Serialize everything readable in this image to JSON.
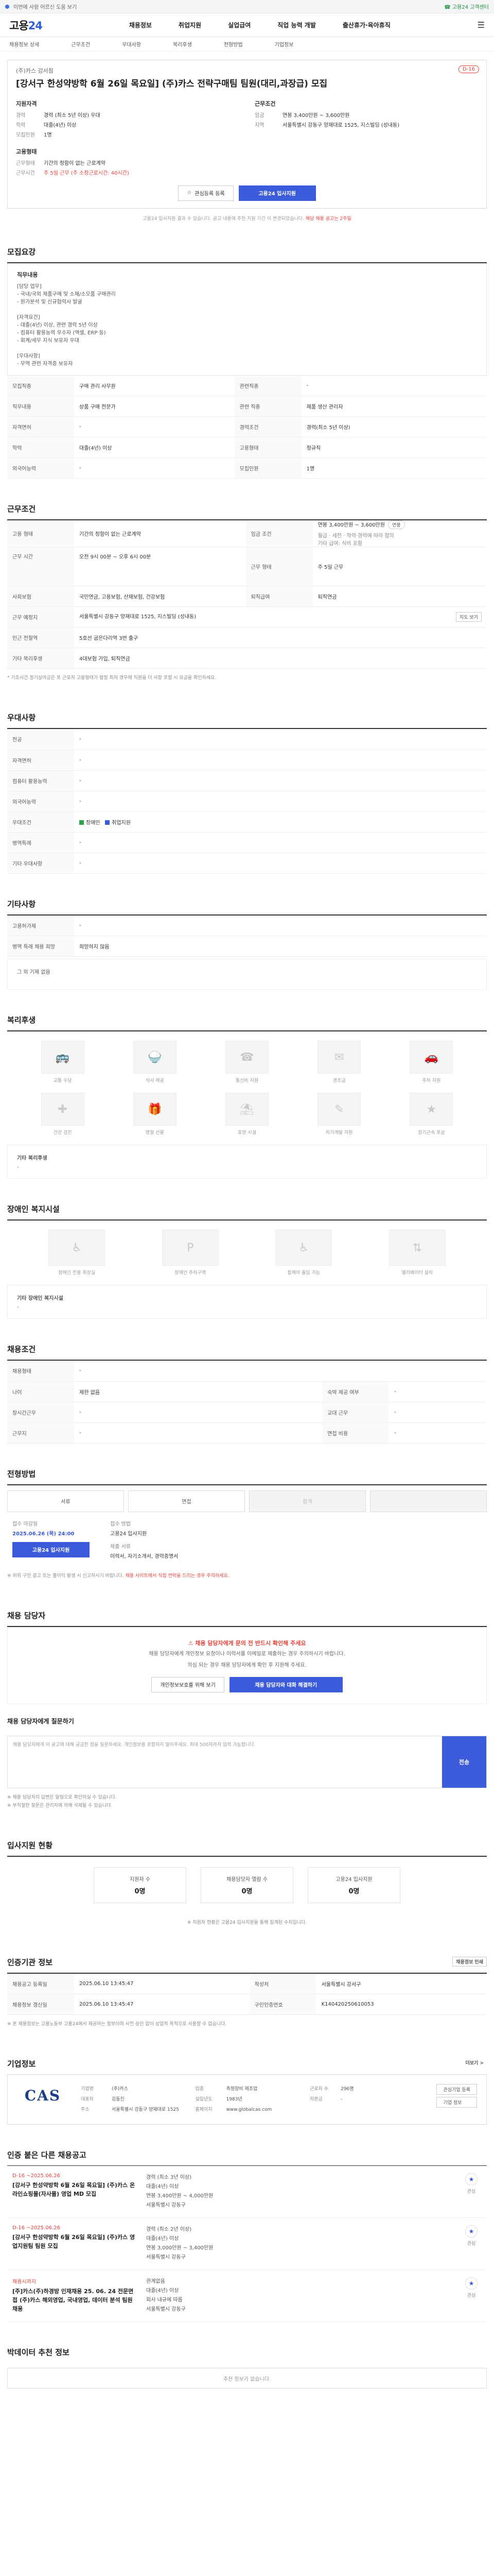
{
  "topbar": {
    "notice": "이번에 사람 어르신 도움 보기",
    "help": "☎ 고용24 고객센터"
  },
  "header": {
    "logo_a": "고용",
    "logo_b": "24",
    "gnb": [
      "채용정보",
      "취업지원",
      "실업급여",
      "직업 능력 개발",
      "출산휴가·육아휴직"
    ]
  },
  "subnav": [
    "채용정보 상세",
    "근무조건",
    "우대사항",
    "복리후생",
    "전형방법",
    "기업정보"
  ],
  "job": {
    "dday": "D-16",
    "company": "(주)카스 강서점",
    "title": "[강서구 한성약방학 6월 26일 목요일] (주)카스 전략구매팀 팀원(대리,과장급) 모집",
    "left_head": "지원자격",
    "left": [
      {
        "k": "경력",
        "v": "경력 (최소 5년 이상) 우대"
      },
      {
        "k": "학력",
        "v": "대졸(4년) 이상"
      },
      {
        "k": "모집인원",
        "v": "1명"
      }
    ],
    "right_head": "근무조건",
    "right": [
      {
        "k": "임금",
        "v": "연봉 3,400만원 ~ 3,600만원"
      },
      {
        "k": "지역",
        "v": "서울특별시 강동구 양재대로 1525, 지스빌딩 (성내동)"
      }
    ],
    "left2_head": "고용형태",
    "left2": [
      {
        "k": "근무형태",
        "v": "기간의 정함이 없는 근로계약"
      },
      {
        "k": "근무시간",
        "v": "주 5일 근무 (주 소정근로시간: 40시간)"
      }
    ],
    "scrap": "관심등록 등록",
    "apply": "고용24 입사지원",
    "note": "고용24 입사지원 결과 수 있습니다. 공고 내용에 추천 지원 기간 이 변경되었습니다.",
    "note_red": "해당 채용 공고는 2주일"
  },
  "detail": {
    "title": "모집요강",
    "heading": "직무내용",
    "lines": [
      "[담당 업무]",
      "- 국내/국외 제품구매 및 소재/소모품 구매관리",
      "- 원가분석 및 신규협력사 발굴",
      "",
      "[자격요건]",
      "- 대졸(4년) 이상, 관련 경력 5년 이상",
      "- 컴퓨터 활용능력 우수자 (엑셀, ERP 등)",
      "- 회계/세무 지식 보유자 우대",
      "",
      "[우대사항]",
      "- 무역 관련 자격증 보유자"
    ],
    "btn": "상세보기 ▾"
  },
  "recruit_tbl": [
    {
      "k": "모집직종",
      "v": "구매 관리 사무원",
      "k2": "관련직종",
      "v2": "-"
    },
    {
      "k": "직무내용",
      "v": "상품 구매 전문가",
      "k2": "관련 직종",
      "v2": "제품 생산 관리자"
    },
    {
      "k": "자격면허",
      "v": "-",
      "k2": "경력조건",
      "v2": "경력(최소 5년 이상)"
    },
    {
      "k": "학력",
      "v": "대졸(4년) 이상",
      "k2": "고용형태",
      "v2": "정규직"
    },
    {
      "k": "외국어능력",
      "v": "-",
      "k2": "모집인원",
      "v2": "1명"
    }
  ],
  "work": {
    "title": "근무조건",
    "rows": [
      {
        "k": "고용 형태",
        "v": "기간의 정함이 없는 근로계약",
        "k2": "임금 조건",
        "v2": "연봉 3,400만원 ~ 3,600만원",
        "pill": "연봉"
      },
      {
        "k": "근무 시간",
        "v": "오전 9시 00분 ~ 오후 6시 00분",
        "k2": "근무 형태",
        "v2": "주 5일 근무"
      },
      {
        "k": "사회보험",
        "v": "국민연금, 고용보험, 산재보험, 건강보험",
        "k2": "퇴직급여",
        "v2": "퇴직연금"
      },
      {
        "k": "근무 예정지",
        "v": "서울특별시 강동구 양재대로 1525, 지스빌딩 (성내동)",
        "k2": "",
        "v2": "",
        "btn": "지도 보기"
      },
      {
        "k": "인근 전철역",
        "v": "5호선 굽은다리역 3번 출구",
        "k2": "",
        "v2": ""
      },
      {
        "k": "기타 복리후생",
        "v": "4대보험 가입, 퇴직연금",
        "k2": "",
        "v2": ""
      }
    ],
    "pay_note": "월급 · 세전 · 학력·경력에 따라 협의",
    "pay_note2": "기타 급여: 식비 포함",
    "footnote": "* 기초시간 정기상여금은 포 근로자 고용형태가 법정 최저 경우에 직원을 더 사항 포함 시 요금을 확인하세요."
  },
  "pref": {
    "title": "우대사항",
    "rows": [
      {
        "k": "전공",
        "v": "-"
      },
      {
        "k": "자격면허",
        "v": "-"
      },
      {
        "k": "컴퓨터 활용능력",
        "v": "-"
      },
      {
        "k": "외국어능력",
        "v": "-"
      },
      {
        "k": "우대조건",
        "v1": "장애인",
        "v2": "취업지원"
      },
      {
        "k": "병역특례",
        "v": "-"
      },
      {
        "k": "기타 우대사항",
        "v": "-"
      }
    ]
  },
  "etc": {
    "title": "기타사항",
    "rows": [
      {
        "k": "고용허가제",
        "v": "-"
      },
      {
        "k": "병역 특례 채용 희망",
        "v": "희망하지 않음"
      }
    ],
    "extra": "그 외 기재 없음"
  },
  "welfare": {
    "title": "복리후생",
    "items": [
      "교통 수당",
      "식사 제공",
      "통신비 지원",
      "경조금",
      "주차 지원",
      "건강 검진",
      "명절 선물",
      "휴양 시설",
      "자기계발 지원",
      "장기근속 포상"
    ],
    "other_head": "기타 복리후생",
    "other": "-"
  },
  "disable": {
    "title": "장애인 복지시설",
    "items": [
      "장애인 전용 화장실",
      "장애인 주차구역",
      "휠체어 출입 가능",
      "엘리베이터 설치"
    ],
    "other_head": "기타 장애인 복지시설",
    "other": "-"
  },
  "cond": {
    "title": "채용조건",
    "rows": [
      {
        "k": "채용형태",
        "v": "-"
      },
      {
        "k": "나이",
        "v": "제한 없음",
        "k2": "숙박 제공 여부",
        "v2": "-"
      },
      {
        "k": "장시간근무",
        "v": "-",
        "k2": "교대 근무",
        "v2": "-"
      },
      {
        "k": "근무지",
        "v": "-",
        "k2": "면접 비용",
        "v2": "-"
      }
    ]
  },
  "process": {
    "title": "전형방법",
    "steps": [
      "서류",
      "면접",
      "합격",
      ""
    ],
    "period_head": "접수 마감일",
    "period_val": "2025.06.26 (목) 24:00",
    "period_head2": "접수 방법",
    "period_val2": "고용24 입사지원",
    "submit_head": "제출 서류",
    "submit_val": "이력서, 자기소개서, 경력증명서",
    "apply_btn": "고용24 입사지원",
    "note": "※ 허위 구인 광고 또는 불이익 발생 시 신고하시기 바랍니다.",
    "note_red": "채용 사이트에서 직접 연락을 드리는 경우 주의하세요."
  },
  "contact": {
    "title": "채용 담당자",
    "warn": "채용 담당자에게 문의 전 반드시 확인해 주세요",
    "desc": "채용 담당자에게 개인정보 요청이나 이력서를 이메일로 제출하는 경우 주의하시기 바랍니다.",
    "desc2": "의심 되는 경우 채용 담당자에게 확인 후 지원해 주세요.",
    "btn1": "개인정보보호를 위해 보기",
    "btn2": "채용 담당자와 대화 해결하기"
  },
  "inquiry": {
    "title": "채용 담당자에게 질문하기",
    "placeholder": "채용 담당자에게 이 공고에 대해 궁금한 점을 질문하세요. 개인정보를 포함하지 말아주세요. 최대 500자까지 입력 가능합니다.",
    "btn": "전송",
    "note1": "※ 채용 담당자의 답변은 알림으로 확인하실 수 있습니다.",
    "note2": "※ 부적절한 질문은 관리자에 의해 삭제될 수 있습니다."
  },
  "stats": {
    "title": "입사지원 현황",
    "items": [
      {
        "l": "지원자 수",
        "v": "0명"
      },
      {
        "l": "채용담당자 열람 수",
        "v": "0명"
      },
      {
        "l": "고용24 입사지원",
        "v": "0명"
      }
    ],
    "note": "※ 지원자 현황은 고용24 입사지원을 통해 집계된 수치입니다."
  },
  "info": {
    "title": "인증기관 정보",
    "rows": [
      {
        "k": "채용공고 등록일",
        "v": "2025.06.10 13:45:47",
        "k2": "작성처",
        "v2": "서울특별시 강서구"
      },
      {
        "k": "채용정보 갱신일",
        "v": "2025.06.10 13:45:47",
        "k2": "구인인증번호",
        "v2": "K140420250610053"
      }
    ],
    "note": "※ 본 채용정보는 고용노동부 고용24에서 제공하는 정보이며 사전 승인 없이 상업적 목적으로 사용할 수 없습니다.",
    "btn": "채용정보 인쇄"
  },
  "company": {
    "title": "기업정보",
    "more": "더보기 >",
    "logo": "CAS",
    "rows": [
      {
        "k": "기업명",
        "v": "(주)카스",
        "k2": "업종",
        "v2": "측정장비 제조업",
        "k3": "근로자 수",
        "v3": "296명"
      },
      {
        "k": "대표자",
        "v": "김동진",
        "k2": "설립년도",
        "v2": "1983년",
        "k3": "자본금",
        "v3": "-"
      },
      {
        "k": "주소",
        "v": "서울특별시 강동구 양재대로 1525",
        "k2": "홈페이지",
        "v2": "www.globalcas.com",
        "k3": "",
        "v3": ""
      }
    ],
    "btn1": "관심기업 등록",
    "btn2": "기업 정보"
  },
  "related": {
    "title": "인증 붙은 다른 채용공고",
    "items": [
      {
        "d": "D-16 ~2025.06.26",
        "t": "[강서구 한성약방학 6월 26일 목요일] (주)카스 온라인쇼핑몰(자사몰) 영업 MD 모집",
        "m1": "경력 (최소 3년 이상)",
        "m2": "대졸(4년) 이상",
        "m3": "연봉 3,400만원 ~ 4,000만원",
        "m4": "서울특별시 강동구"
      },
      {
        "d": "D-16 ~2025.06.26",
        "t": "[강서구 한성약방학 6월 26일 목요일] (주)카스 영업지원팀 팀원 모집",
        "m1": "경력 (최소 2년 이상)",
        "m2": "대졸(4년) 이상",
        "m3": "연봉 3,000만원 ~ 3,400만원",
        "m4": "서울특별시 강동구"
      },
      {
        "d": "채용시까지",
        "t": "[주]카스(주)하경방 인재채용 25. 06. 24 전문면접 (주)카스 해외영업, 국내영업, 데이터 분석 팀원 채용",
        "m1": "관계없음",
        "m2": "대졸(4년) 이상",
        "m3": "회사 내규에 따름",
        "m4": "서울특별시 강동구"
      }
    ],
    "scrap": "관심"
  },
  "bottom": {
    "title": "박데이터 추천 정보",
    "empty": "추천 정보가 없습니다."
  }
}
